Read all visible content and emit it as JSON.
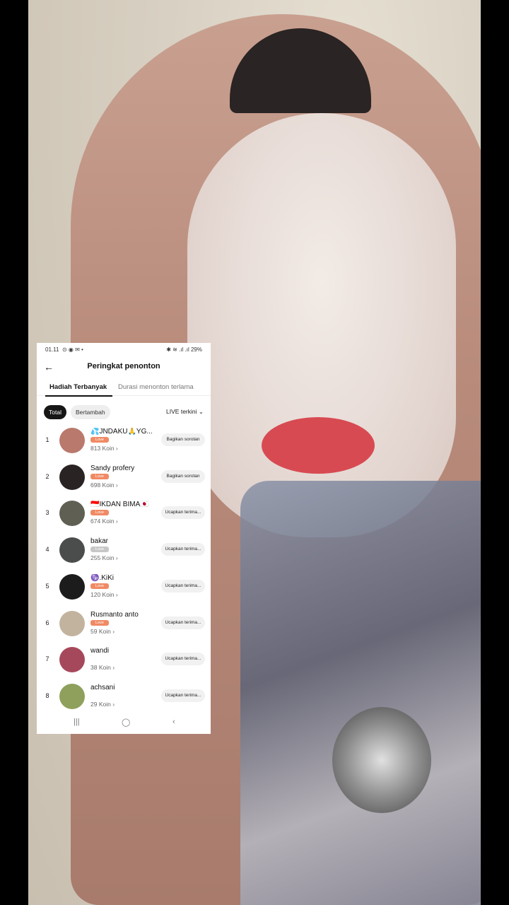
{
  "status": {
    "time": "01.11",
    "icons_left": "⊙ ◉ ✉ •",
    "icons_right": "✱ ≋ .ıl .ıl",
    "battery": "29%"
  },
  "header": {
    "title": "Peringkat penonton"
  },
  "tabs": [
    {
      "label": "Hadiah Terbanyak"
    },
    {
      "label": "Durasi menonton terlama"
    }
  ],
  "filters": {
    "total": "Total",
    "increase": "Bertambah",
    "live": "LIVE terkini ⌄"
  },
  "rows": [
    {
      "rank": "1",
      "name": "💦JNDAKU🙏YG...",
      "badge": "Love",
      "coins": "813 Koin ›",
      "action": "Bagikan sorotan",
      "avatar_color": "#b9796d",
      "badge_color": "#f08a64"
    },
    {
      "rank": "2",
      "name": "Sandy profery",
      "badge": "Love",
      "coins": "698 Koin ›",
      "action": "Bagikan sorotan",
      "avatar_color": "#2a2323",
      "badge_color": "#f08a64"
    },
    {
      "rank": "3",
      "name": "🇮🇩IKDAN BIMA🇯🇵",
      "badge": "Love",
      "coins": "674 Koin ›",
      "action": "Ucapkan terima...",
      "avatar_color": "#5f5f54",
      "badge_color": "#f08a64"
    },
    {
      "rank": "4",
      "name": "bakar",
      "badge": "Love",
      "coins": "255 Koin ›",
      "action": "Ucapkan terima...",
      "avatar_color": "#4a4d4b",
      "badge_color": "#c7c7c7"
    },
    {
      "rank": "5",
      "name": "♑.KiKi",
      "badge": "Love",
      "coins": "120 Koin ›",
      "action": "Ucapkan terima...",
      "avatar_color": "#1c1c1c",
      "badge_color": "#f08a64"
    },
    {
      "rank": "6",
      "name": "Rusmanto anto",
      "badge": "Love",
      "coins": "59 Koin ›",
      "action": "Ucapkan terima...",
      "avatar_color": "#c2b39f",
      "badge_color": "#f08a64"
    },
    {
      "rank": "7",
      "name": "wandi",
      "badge": "",
      "coins": "38 Koin ›",
      "action": "Ucapkan terima...",
      "avatar_color": "#a6485b",
      "badge_color": "#ffffff"
    },
    {
      "rank": "8",
      "name": "achsani",
      "badge": "",
      "coins": "29 Koin ›",
      "action": "Ucapkan terima...",
      "avatar_color": "#8ea05c",
      "badge_color": "#ffffff"
    }
  ],
  "navbar": {
    "recent": "|||",
    "home": "◯",
    "back": "‹"
  }
}
